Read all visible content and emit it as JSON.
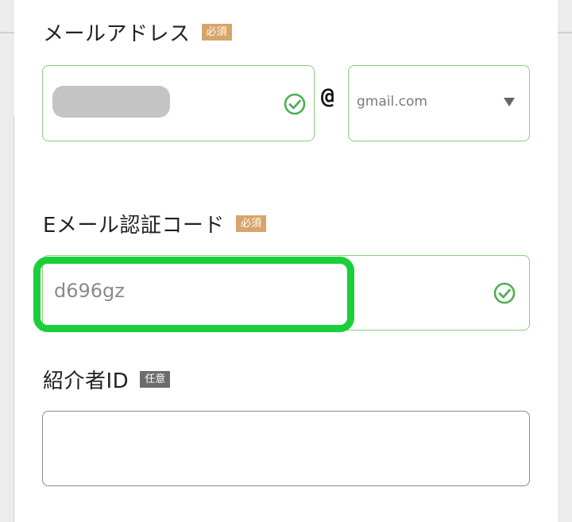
{
  "email": {
    "label": "メールアドレス",
    "badge": "必須",
    "at_symbol": "@",
    "domain_selected": "gmail.com",
    "local_part_state": "blurred"
  },
  "verification": {
    "label": "Eメール認証コード",
    "badge": "必須",
    "value": "d696gz"
  },
  "referrer": {
    "label": "紹介者ID",
    "badge": "任意",
    "value": ""
  },
  "colors": {
    "valid_border": "#8ccc7d",
    "valid_icon": "#4caf50",
    "required_badge": "#d7a56b",
    "optional_badge": "#6c6c6c",
    "highlight": "#1bcf3a"
  },
  "icons": [
    "check-circle-icon",
    "chevron-down-icon"
  ]
}
